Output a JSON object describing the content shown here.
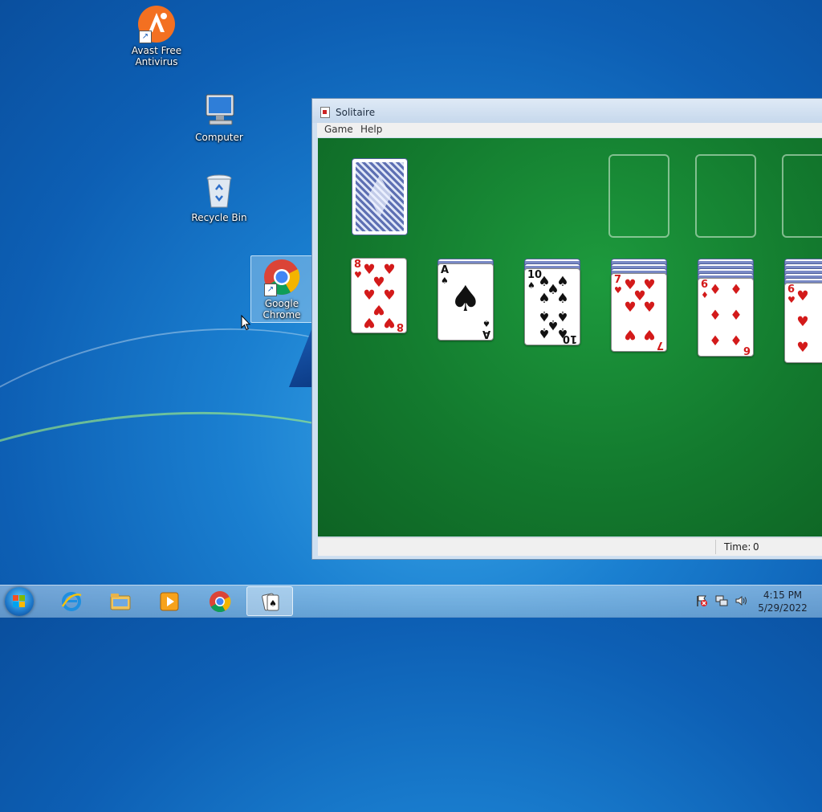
{
  "desktop": {
    "icons": [
      {
        "label_line1": "Avast Free",
        "label_line2": "Antivirus",
        "icon": "avast-icon"
      },
      {
        "label_line1": "Computer",
        "label_line2": "",
        "icon": "computer-icon"
      },
      {
        "label_line1": "Recycle Bin",
        "label_line2": "",
        "icon": "recycle-bin-icon"
      },
      {
        "label_line1": "Google",
        "label_line2": "Chrome",
        "icon": "chrome-icon"
      }
    ]
  },
  "window": {
    "title": "Solitaire",
    "menu": [
      "Game",
      "Help"
    ],
    "status": {
      "time_label": "Time:",
      "time_value": "0"
    }
  },
  "tableau": [
    {
      "rank": "8",
      "suit": "♥",
      "color": "red"
    },
    {
      "rank": "A",
      "suit": "♠",
      "color": "black"
    },
    {
      "rank": "10",
      "suit": "♠",
      "color": "black"
    },
    {
      "rank": "7",
      "suit": "♥",
      "color": "red"
    },
    {
      "rank": "6",
      "suit": "♦",
      "color": "red"
    },
    {
      "rank": "6",
      "suit": "♥",
      "color": "red"
    }
  ],
  "taskbar": {
    "apps": [
      "internet-explorer-icon",
      "file-explorer-icon",
      "media-player-icon",
      "chrome-icon",
      "solitaire-icon"
    ],
    "active_app": "solitaire-icon",
    "clock": {
      "time": "4:15 PM",
      "date": "5/29/2022"
    }
  },
  "colors": {
    "felt": "#137a2e",
    "red_suit": "#d31a1a",
    "black_suit": "#111111"
  }
}
